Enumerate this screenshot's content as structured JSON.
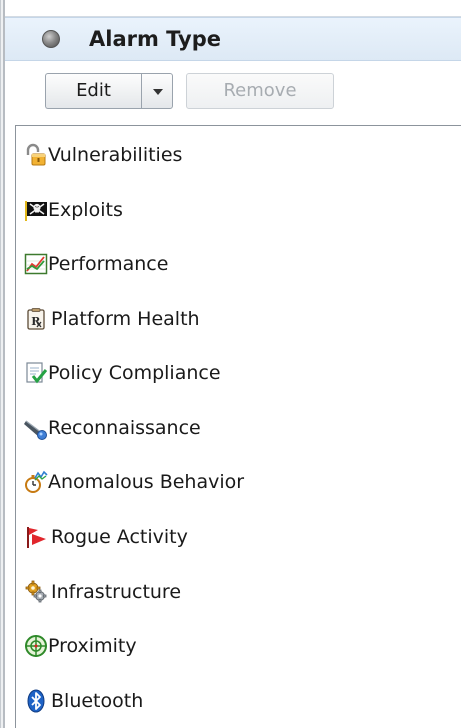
{
  "panel": {
    "title": "Alarm Type"
  },
  "toolbar": {
    "edit_label": "Edit",
    "remove_label": "Remove"
  },
  "alarm_types": [
    {
      "label": "Vulnerabilities",
      "icon": "padlock-icon"
    },
    {
      "label": "Exploits",
      "icon": "skull-flag-icon"
    },
    {
      "label": "Performance",
      "icon": "line-chart-icon"
    },
    {
      "label": "Platform Health",
      "icon": "prescription-icon"
    },
    {
      "label": "Policy Compliance",
      "icon": "document-check-icon"
    },
    {
      "label": "Reconnaissance",
      "icon": "telescope-icon"
    },
    {
      "label": "Anomalous Behavior",
      "icon": "stopwatch-chart-icon"
    },
    {
      "label": "Rogue Activity",
      "icon": "red-flag-icon"
    },
    {
      "label": "Infrastructure",
      "icon": "gears-icon"
    },
    {
      "label": "Proximity",
      "icon": "crosshair-icon"
    },
    {
      "label": "Bluetooth",
      "icon": "bluetooth-icon"
    }
  ],
  "colors": {
    "header_bg": "#e3eef9",
    "disabled_text": "#a7acb1"
  }
}
